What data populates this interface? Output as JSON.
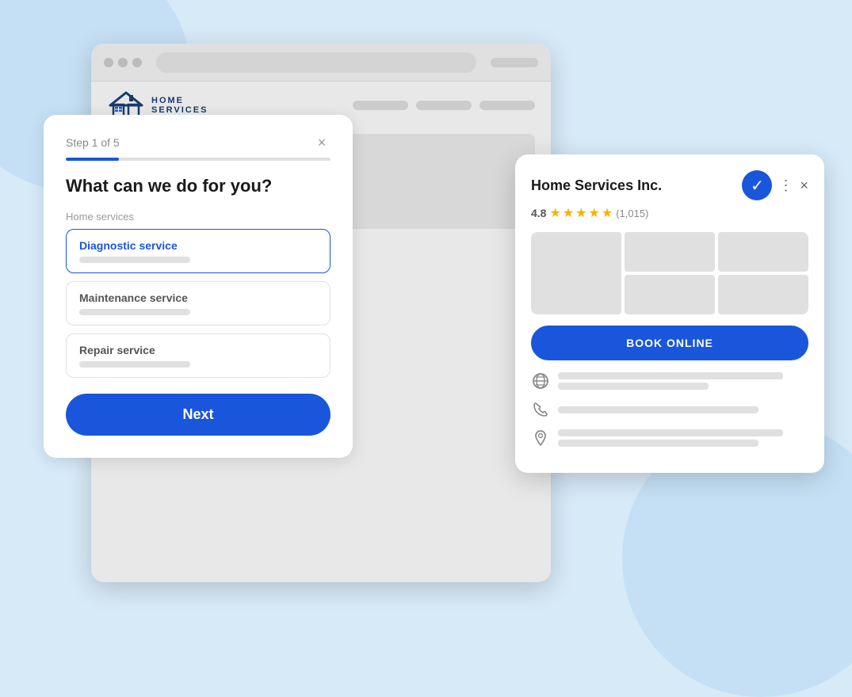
{
  "app": {
    "logo_text": "HOME",
    "logo_subtext": "SERVICES"
  },
  "browser": {
    "dots": [
      "dot1",
      "dot2",
      "dot3"
    ]
  },
  "step_form": {
    "step_label": "Step 1 of 5",
    "close_label": "×",
    "progress_percent": 20,
    "question": "What can we do for you?",
    "services_label": "Home services",
    "services": [
      {
        "id": "diagnostic",
        "title": "Diagnostic service",
        "selected": true
      },
      {
        "id": "maintenance",
        "title": "Maintenance service",
        "selected": false
      },
      {
        "id": "repair",
        "title": "Repair service",
        "selected": false
      }
    ],
    "next_button": "Next"
  },
  "business_card": {
    "name": "Home Services Inc.",
    "verified": true,
    "rating": "4.8",
    "stars": 4.8,
    "review_count": "(1,015)",
    "book_button": "BOOK ONLINE",
    "dots_icon": "⋮",
    "close_icon": "×",
    "info_rows": [
      {
        "icon": "globe",
        "lines": [
          "long",
          "short"
        ]
      },
      {
        "icon": "phone",
        "lines": [
          "medium"
        ]
      },
      {
        "icon": "location",
        "lines": [
          "long",
          "short"
        ]
      }
    ]
  },
  "background": {
    "color": "#d6eaf8",
    "circle_color": "#c5e0f5"
  }
}
